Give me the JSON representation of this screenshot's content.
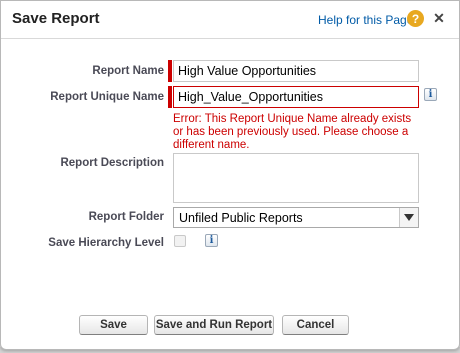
{
  "dialog": {
    "title": "Save Report",
    "help_link": "Help for this Page",
    "help_icon": "?",
    "close_icon": "✕"
  },
  "form": {
    "report_name": {
      "label": "Report Name",
      "value": "High Value Opportunities"
    },
    "unique_name": {
      "label": "Report Unique Name",
      "value": "High_Value_Opportunities",
      "error": "Error: This Report Unique Name already exists or has been previously used. Please choose a different name."
    },
    "description": {
      "label": "Report Description",
      "value": ""
    },
    "folder": {
      "label": "Report Folder",
      "value": "Unfiled Public Reports"
    },
    "hierarchy": {
      "label": "Save Hierarchy Level",
      "checked": false
    },
    "info_icon": "i"
  },
  "buttons": {
    "save": "Save",
    "save_run": "Save and Run Report",
    "cancel": "Cancel"
  },
  "colors": {
    "required": "#cc0000",
    "error_text": "#cc0000",
    "help_link": "#015ba7",
    "help_icon": "#e8a820"
  }
}
